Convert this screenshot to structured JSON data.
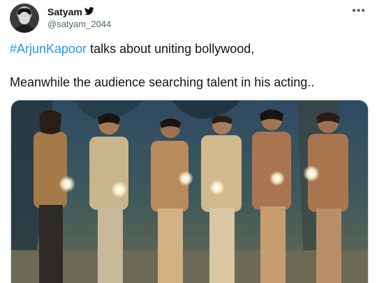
{
  "tweet": {
    "author_name": "Satyam",
    "author_handle": "@satyam_2044",
    "hashtag": "#ArjunKapoor",
    "line1_rest": " talks about uniting bollywood,",
    "line2": "Meanwhile the audience searching talent in his acting.."
  },
  "icons": {
    "verified": "twitter-bird-icon",
    "more": "more-options-icon",
    "more_glyph": "•••"
  },
  "media": {
    "image_name": "retro-film-still-six-men-holding-lights"
  },
  "colors": {
    "hashtag": "#1d9bf0",
    "secondary_text": "#536471"
  }
}
